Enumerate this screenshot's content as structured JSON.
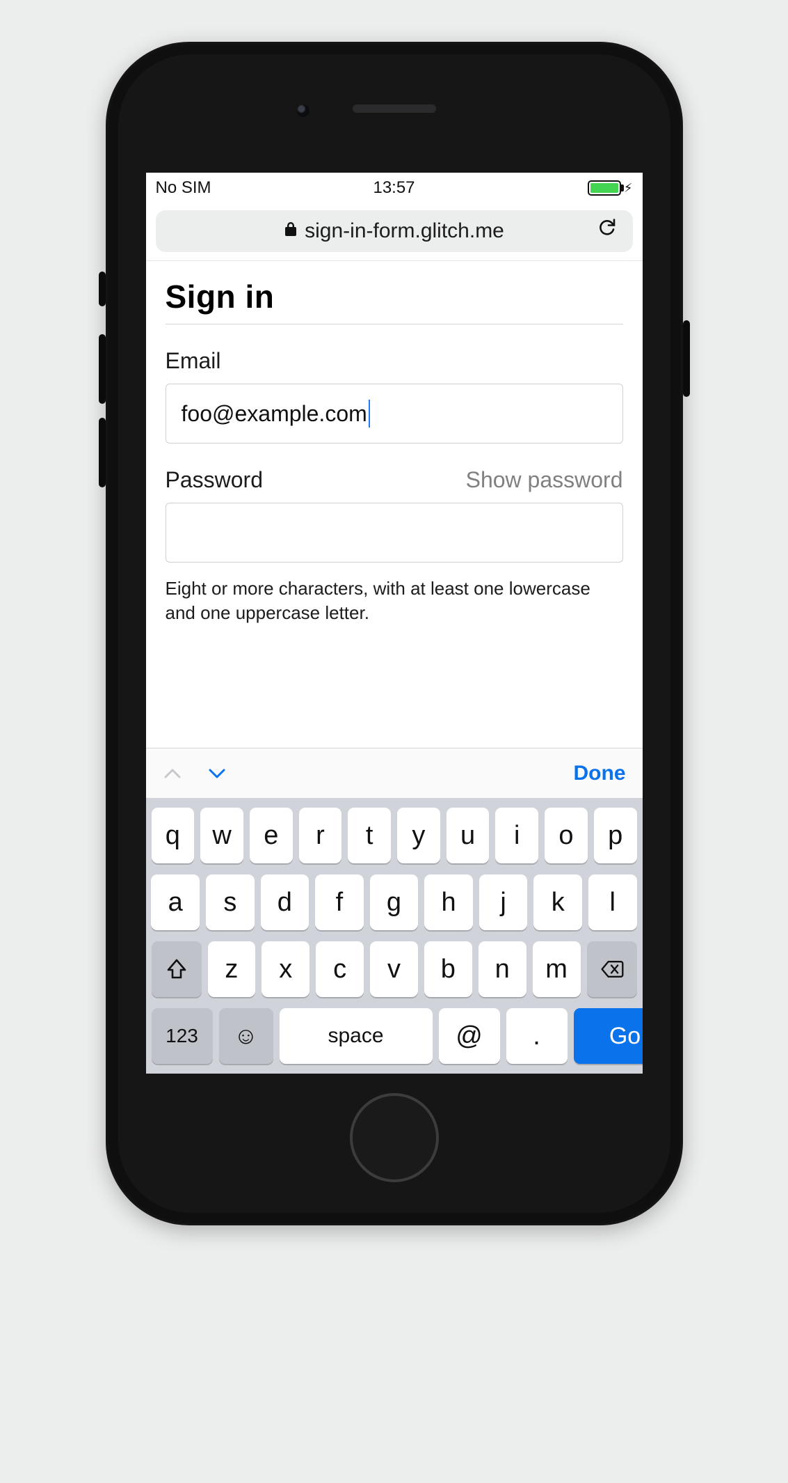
{
  "statusbar": {
    "carrier": "No SIM",
    "time": "13:57"
  },
  "urlbar": {
    "host": "sign-in-form.glitch.me"
  },
  "page": {
    "heading": "Sign in",
    "email": {
      "label": "Email",
      "value": "foo@example.com"
    },
    "password": {
      "label": "Password",
      "toggle_label": "Show password",
      "value": "",
      "hint": "Eight or more characters, with at least one lowercase and one uppercase letter."
    }
  },
  "keyboard": {
    "toolbar": {
      "done_label": "Done"
    },
    "row1": [
      "q",
      "w",
      "e",
      "r",
      "t",
      "y",
      "u",
      "i",
      "o",
      "p"
    ],
    "row2": [
      "a",
      "s",
      "d",
      "f",
      "g",
      "h",
      "j",
      "k",
      "l"
    ],
    "row3": [
      "z",
      "x",
      "c",
      "v",
      "b",
      "n",
      "m"
    ],
    "row4": {
      "numeric": "123",
      "space": "space",
      "at": "@",
      "dot": ".",
      "go": "Go"
    }
  }
}
